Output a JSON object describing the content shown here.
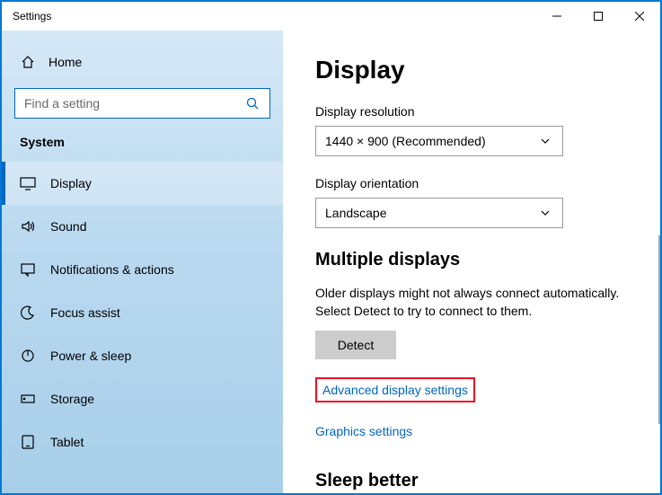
{
  "window": {
    "title": "Settings"
  },
  "sidebar": {
    "home_label": "Home",
    "search_placeholder": "Find a setting",
    "category": "System",
    "items": [
      {
        "label": "Display"
      },
      {
        "label": "Sound"
      },
      {
        "label": "Notifications & actions"
      },
      {
        "label": "Focus assist"
      },
      {
        "label": "Power & sleep"
      },
      {
        "label": "Storage"
      },
      {
        "label": "Tablet"
      }
    ]
  },
  "main": {
    "title": "Display",
    "resolution": {
      "label": "Display resolution",
      "value": "1440 × 900 (Recommended)"
    },
    "orientation": {
      "label": "Display orientation",
      "value": "Landscape"
    },
    "multiple": {
      "heading": "Multiple displays",
      "desc": "Older displays might not always connect automatically. Select Detect to try to connect to them.",
      "detect": "Detect"
    },
    "links": {
      "advanced": "Advanced display settings",
      "graphics": "Graphics settings"
    },
    "sleep_heading": "Sleep better"
  }
}
